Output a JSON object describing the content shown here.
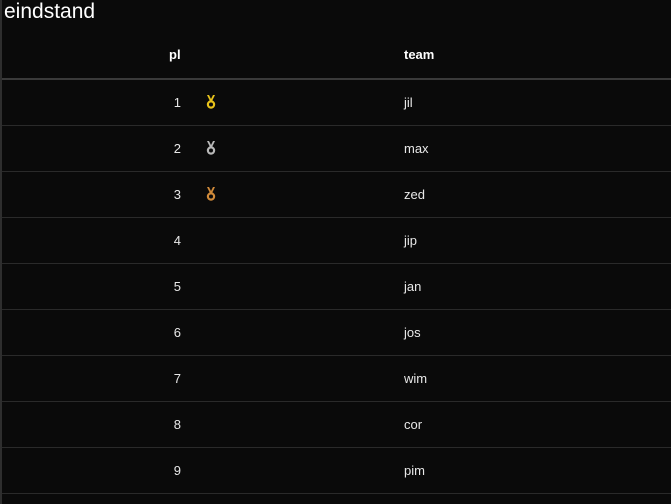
{
  "title": "eindstand",
  "table": {
    "headers": {
      "place": "pl",
      "team": "team"
    },
    "rows": [
      {
        "place": "1",
        "team": "jil",
        "medal": "gold-medal-icon",
        "medal_color": "#e8c21a"
      },
      {
        "place": "2",
        "team": "max",
        "medal": "silver-medal-icon",
        "medal_color": "#b8b8b8"
      },
      {
        "place": "3",
        "team": "zed",
        "medal": "bronze-medal-icon",
        "medal_color": "#d08a3a"
      },
      {
        "place": "4",
        "team": "jip"
      },
      {
        "place": "5",
        "team": "jan"
      },
      {
        "place": "6",
        "team": "jos"
      },
      {
        "place": "7",
        "team": "wim"
      },
      {
        "place": "8",
        "team": "cor"
      },
      {
        "place": "9",
        "team": "pim"
      }
    ]
  }
}
